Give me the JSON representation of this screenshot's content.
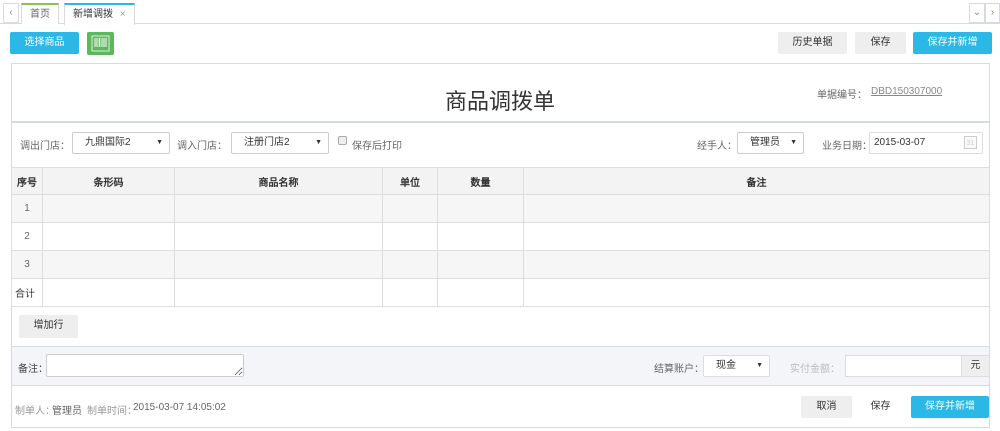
{
  "tabs": {
    "prev": "‹",
    "items": [
      "首页",
      "新增调拨"
    ],
    "close": "×",
    "dropdown": "⌄",
    "next": "›"
  },
  "toolbar": {
    "select_goods": "选择商品",
    "history": "历史单据",
    "save": "保存",
    "save_new": "保存并新增"
  },
  "form": {
    "title": "商品调拨单",
    "doc_no_label": "单据编号：",
    "doc_no": "DBD150307000",
    "out_store_label": "调出门店：",
    "out_store": "九鼎国际2",
    "in_store_label": "调入门店：",
    "in_store": "注册门店2",
    "print_after_save": "保存后打印",
    "handler_label": "经手人：",
    "handler": "管理员",
    "date_label": "业务日期：",
    "date": "2015-03-07",
    "calendar_day": "31"
  },
  "table": {
    "headers": [
      "序号",
      "条形码",
      "商品名称",
      "单位",
      "数量",
      "备注"
    ],
    "rows": [
      "1",
      "2",
      "3"
    ],
    "total": "合计"
  },
  "add_row": "增加行",
  "remark_label": "备注：",
  "account_label": "结算账户：",
  "account": "现金",
  "paid_label": "实付金额：",
  "currency": "元",
  "footer": {
    "creator_label": "制单人：",
    "creator": "管理员",
    "time_label": "制单时间：",
    "time": "2015-03-07 14:05:02",
    "cancel": "取消",
    "save": "保存",
    "save_new": "保存并新增"
  }
}
